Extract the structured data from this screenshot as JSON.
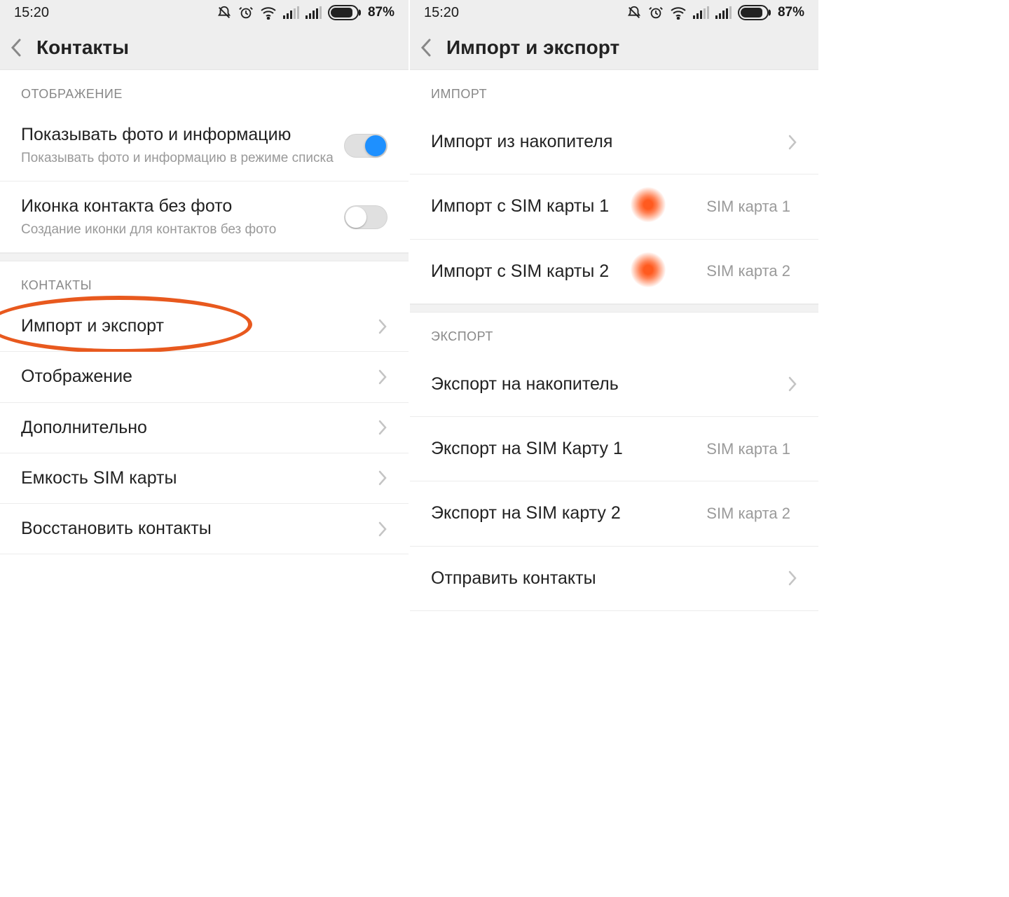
{
  "status": {
    "time": "15:20",
    "battery_text": "87%",
    "battery_level": 87
  },
  "left": {
    "header_title": "Контакты",
    "section_display": "ОТОБРАЖЕНИЕ",
    "show_photo": {
      "title": "Показывать фото и информацию",
      "sub": "Показывать фото и информацию в режиме списка",
      "on": true
    },
    "icon_no_photo": {
      "title": "Иконка контакта без фото",
      "sub": "Создание иконки для контактов без фото",
      "on": false
    },
    "section_contacts": "КОНТАКТЫ",
    "items": {
      "import_export": "Импорт и экспорт",
      "display": "Отображение",
      "advanced": "Дополнительно",
      "sim_capacity": "Емкость SIM карты",
      "restore": "Восстановить контакты"
    }
  },
  "right": {
    "header_title": "Импорт и экспорт",
    "section_import": "ИМПОРТ",
    "import_storage": "Импорт из накопителя",
    "import_sim1": {
      "label": "Импорт с SIM карты 1",
      "value": "SIM карта 1"
    },
    "import_sim2": {
      "label": "Импорт с SIM карты 2",
      "value": "SIM карта 2"
    },
    "section_export": "ЭКСПОРТ",
    "export_storage": "Экспорт на накопитель",
    "export_sim1": {
      "label": "Экспорт на SIM Карту 1",
      "value": "SIM карта 1"
    },
    "export_sim2": {
      "label": "Экспорт на SIM карту 2",
      "value": "SIM карта 2"
    },
    "send_contacts": "Отправить контакты"
  }
}
